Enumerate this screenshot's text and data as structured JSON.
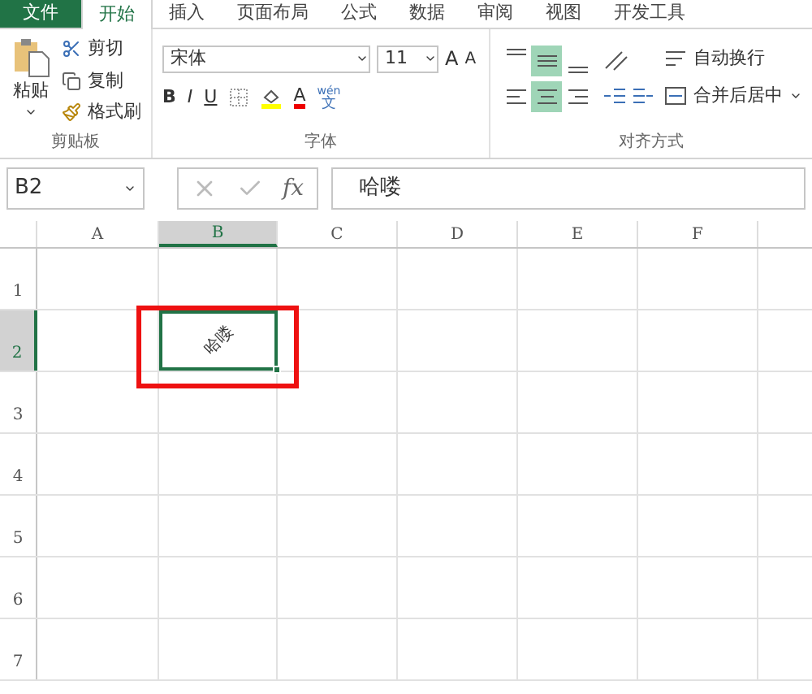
{
  "tabs": [
    {
      "label": "文件",
      "kind": "file",
      "selected": false
    },
    {
      "label": "开始",
      "kind": "tab",
      "selected": true
    },
    {
      "label": "插入",
      "kind": "tab",
      "selected": false
    },
    {
      "label": "页面布局",
      "kind": "tab",
      "selected": false
    },
    {
      "label": "公式",
      "kind": "tab",
      "selected": false
    },
    {
      "label": "数据",
      "kind": "tab",
      "selected": false
    },
    {
      "label": "审阅",
      "kind": "tab",
      "selected": false
    },
    {
      "label": "视图",
      "kind": "tab",
      "selected": false
    },
    {
      "label": "开发工具",
      "kind": "tab",
      "selected": false
    }
  ],
  "clipboard": {
    "paste": "粘贴",
    "cut": "剪切",
    "copy": "复制",
    "format_painter": "格式刷",
    "group_label": "剪贴板"
  },
  "font": {
    "name": "宋体",
    "size": "11",
    "grow": "A",
    "shrink": "A",
    "bold": "B",
    "italic": "I",
    "underline": "U",
    "font_color": "A",
    "phonetic_top": "wén",
    "phonetic_bottom": "文",
    "group_label": "字体"
  },
  "alignment": {
    "vertical": [
      {
        "kind": "top",
        "selected": false
      },
      {
        "kind": "middle",
        "selected": true
      },
      {
        "kind": "bottom",
        "selected": false
      }
    ],
    "horizontal": [
      {
        "kind": "left",
        "selected": false
      },
      {
        "kind": "center",
        "selected": true
      },
      {
        "kind": "right",
        "selected": false
      }
    ],
    "wrap_text": "自动换行",
    "merge_center": "合并后居中",
    "group_label": "对齐方式"
  },
  "formula_bar": {
    "name_box": "B2",
    "fx": "fx",
    "value": "哈喽"
  },
  "columns": [
    {
      "label": "A",
      "selected": false
    },
    {
      "label": "B",
      "selected": true
    },
    {
      "label": "C",
      "selected": false
    },
    {
      "label": "D",
      "selected": false
    },
    {
      "label": "E",
      "selected": false
    },
    {
      "label": "F",
      "selected": false
    }
  ],
  "rows": [
    {
      "label": "1",
      "selected": false
    },
    {
      "label": "2",
      "selected": true
    },
    {
      "label": "3",
      "selected": false
    },
    {
      "label": "4",
      "selected": false
    },
    {
      "label": "5",
      "selected": false
    },
    {
      "label": "6",
      "selected": false
    },
    {
      "label": "7",
      "selected": false
    }
  ],
  "active_cell": {
    "value": "哈喽",
    "rotated": true
  }
}
